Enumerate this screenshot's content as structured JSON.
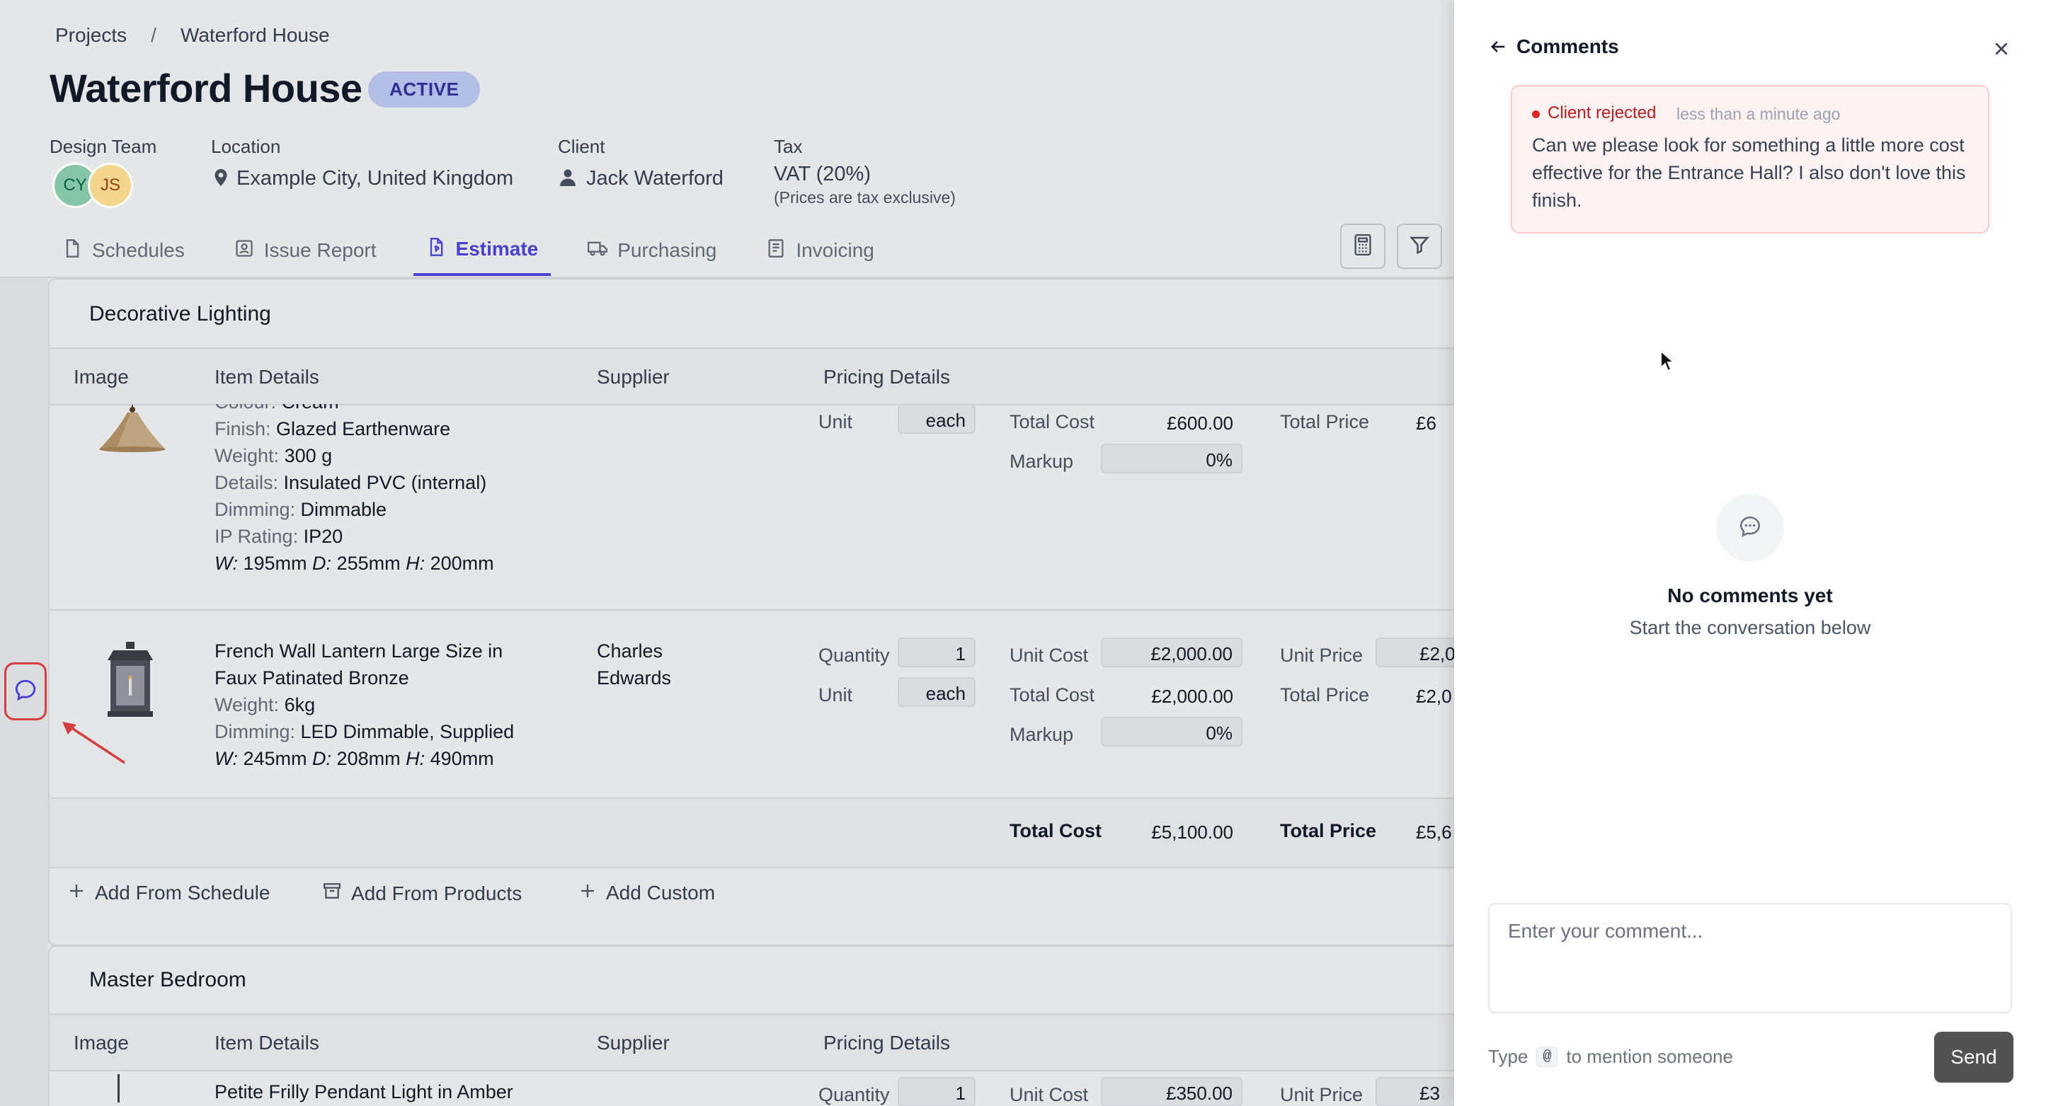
{
  "breadcrumb": {
    "root": "Projects",
    "separator": "/",
    "current": "Waterford House"
  },
  "project": {
    "title": "Waterford House",
    "status": "ACTIVE"
  },
  "meta": {
    "design_team": {
      "label": "Design Team",
      "avatars": [
        "CY",
        "JS"
      ]
    },
    "location": {
      "label": "Location",
      "value": "Example City, United Kingdom"
    },
    "client": {
      "label": "Client",
      "value": "Jack Waterford"
    },
    "tax": {
      "label": "Tax",
      "value": "VAT (20%)",
      "note": "(Prices are tax exclusive)"
    }
  },
  "tabs": [
    {
      "label": "Schedules",
      "icon": "document-icon"
    },
    {
      "label": "Issue Report",
      "icon": "report-icon"
    },
    {
      "label": "Estimate",
      "icon": "estimate-icon",
      "active": true
    },
    {
      "label": "Purchasing",
      "icon": "truck-icon"
    },
    {
      "label": "Invoicing",
      "icon": "invoice-icon"
    }
  ],
  "table_headers": {
    "image": "Image",
    "item_details": "Item Details",
    "supplier": "Supplier",
    "pricing": "Pricing Details"
  },
  "sections": [
    {
      "title": "Decorative Lighting",
      "items": [
        {
          "details": [
            {
              "k": "Colour: ",
              "v": "Cream"
            },
            {
              "k": "Finish: ",
              "v": "Glazed Earthenware"
            },
            {
              "k": "Weight: ",
              "v": "300 g"
            },
            {
              "k": "Details: ",
              "v": "Insulated PVC (internal)"
            },
            {
              "k": "Dimming: ",
              "v": "Dimmable"
            },
            {
              "k": "IP Rating: ",
              "v": "IP20"
            }
          ],
          "dims": {
            "w_label": "W:",
            "w": " 195mm ",
            "d_label": "D:",
            "d": " 255mm ",
            "h_label": "H:",
            "h": " 200mm"
          },
          "unit_label": "Unit",
          "unit": "each",
          "total_cost_label": "Total Cost",
          "total_cost": "£600.00",
          "markup_label": "Markup",
          "markup": "0",
          "total_price_label": "Total Price",
          "total_price": "£6"
        },
        {
          "name_line1": "French Wall Lantern Large Size in",
          "name_line2": "Faux Patinated Bronze",
          "details": [
            {
              "k": "Weight: ",
              "v": "6kg"
            },
            {
              "k": "Dimming: ",
              "v": "LED Dimmable, Supplied"
            }
          ],
          "dims": {
            "w_label": "W:",
            "w": " 245mm ",
            "d_label": "D:",
            "d": " 208mm ",
            "h_label": "H:",
            "h": " 490mm"
          },
          "supplier_line1": "Charles",
          "supplier_line2": "Edwards",
          "quantity_label": "Quantity",
          "quantity": "1",
          "unit_label": "Unit",
          "unit": "each",
          "unit_cost_label": "Unit Cost",
          "unit_cost": "£2,000.00",
          "total_cost_label": "Total Cost",
          "total_cost": "£2,000.00",
          "markup_label": "Markup",
          "markup": "0",
          "unit_price_label": "Unit Price",
          "unit_price": "£2,0",
          "total_price_label": "Total Price",
          "total_price": "£2,0"
        }
      ],
      "totals": {
        "cost_label": "Total Cost",
        "cost": "£5,100.00",
        "price_label": "Total Price",
        "price": "£5,6"
      },
      "actions": [
        "Add From Schedule",
        "Add From Products",
        "Add Custom"
      ]
    },
    {
      "title": "Master Bedroom",
      "partial_item": {
        "name": "Petite Frilly Pendant Light in Amber",
        "quantity_label": "Quantity",
        "quantity": "1",
        "unit_cost_label": "Unit Cost",
        "unit_cost": "£350.00",
        "unit_price_label": "Unit Price",
        "unit_price": "£3"
      }
    }
  ],
  "percent_symbol": "%",
  "comments_panel": {
    "title": "Comments",
    "comment": {
      "status": "Client rejected",
      "time": "less than a minute ago",
      "body": "Can we please look for something a little more cost effective for the Entrance Hall? I also don't love this finish.",
      "status_color": "#dc2626"
    },
    "empty_title": "No comments yet",
    "empty_subtitle": "Start the conversation below",
    "input_placeholder": "Enter your comment...",
    "hint_prefix": "Type",
    "hint_key": "@",
    "hint_suffix": "to mention someone",
    "send_label": "Send"
  },
  "colors": {
    "accent": "#4f46e5",
    "badge_bg": "#c7d2fe",
    "highlight": "#ef4444"
  }
}
